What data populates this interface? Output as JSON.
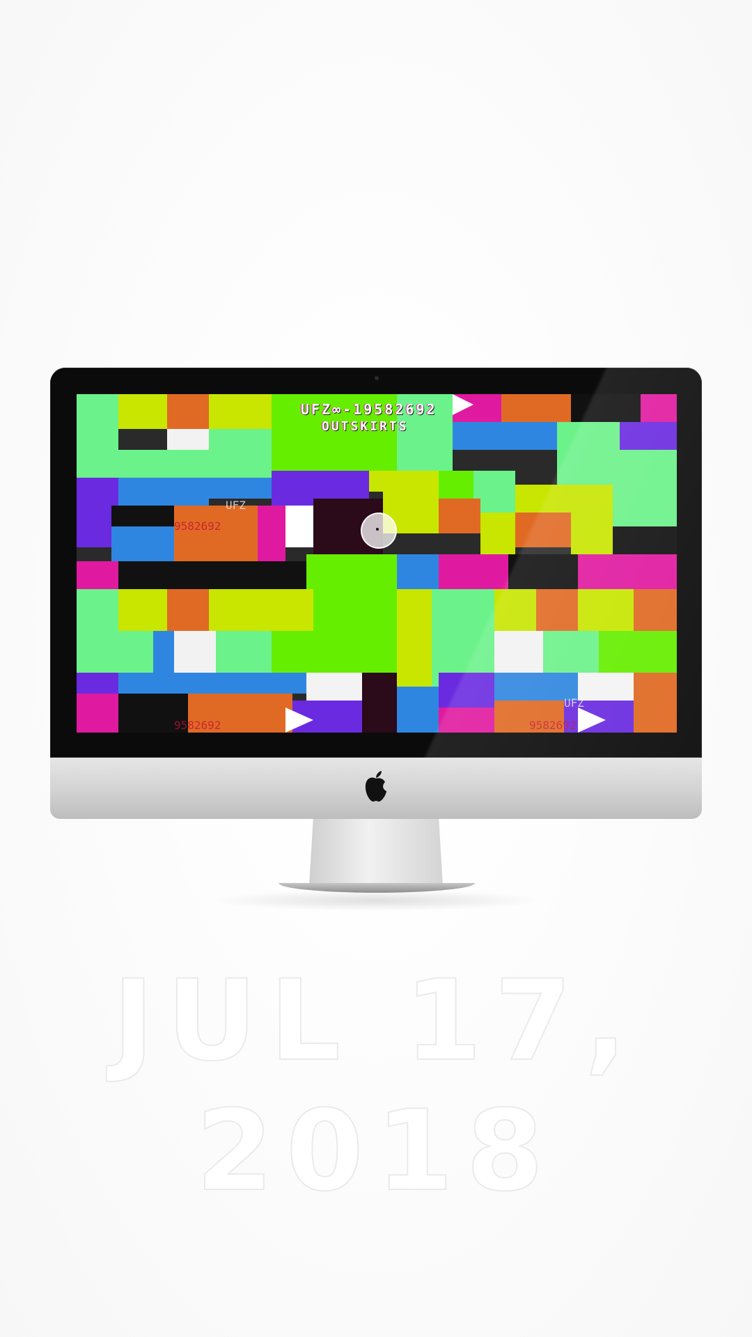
{
  "screen": {
    "code_line": "UFZ∞-19582692",
    "location_line": "OUTSKIRTS",
    "overlay_labels": [
      "9582692",
      "9582692",
      "9582692",
      "UFZ",
      "UFZ"
    ]
  },
  "caption": {
    "date": "JUL 17, 2018"
  },
  "icons": {
    "brand": "apple-logo-icon",
    "cursor": "cursor-ring-icon"
  },
  "colors": {
    "bezel": "#0b0b0b",
    "chin": "#d2d2d2",
    "mint": "#6cf28a",
    "lime": "#c8e600",
    "green": "#66ee00",
    "orange": "#e06a24",
    "blue": "#2f86e0",
    "violet": "#6a2be0",
    "magenta": "#e01aa0",
    "black": "#111111"
  }
}
